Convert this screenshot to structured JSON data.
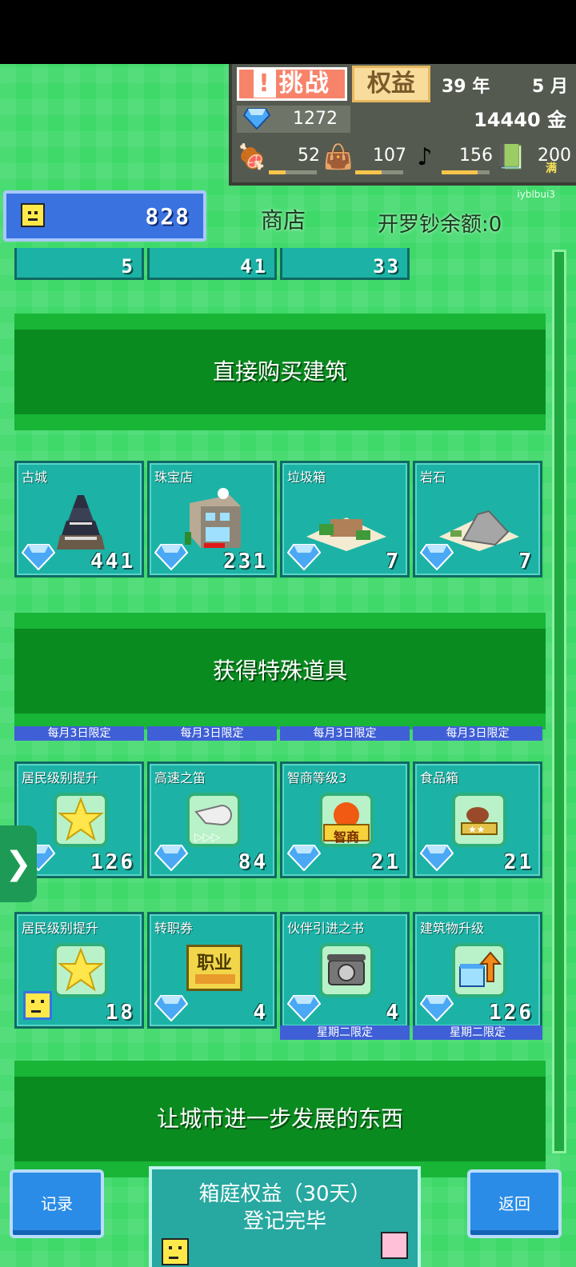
{
  "hud": {
    "challenge_mark": "!",
    "challenge_label": "挑战",
    "rights_label": "权益",
    "year": "39 年",
    "month": "5 月",
    "gems": "1272",
    "gold": "14440 金",
    "stats": [
      {
        "icon": "food-icon",
        "value": "52",
        "fill": 0.35
      },
      {
        "icon": "bag-icon",
        "value": "107",
        "fill": 0.55
      },
      {
        "icon": "music-note-icon",
        "value": "156",
        "fill": 0.75
      },
      {
        "icon": "book-icon",
        "value": "200",
        "fill": 1.0
      }
    ],
    "full_badge": "满"
  },
  "watermark": "iyblbui3",
  "header": {
    "resident_count": "828",
    "shop_title": "商店",
    "cairo_balance": "开罗钞余额:0"
  },
  "partial_row": [
    "5",
    "41",
    "33"
  ],
  "banners": {
    "buy_buildings": "直接购买建筑",
    "special_items": "获得特殊道具",
    "city_growth": "让城市进一步发展的东西"
  },
  "buildings": [
    {
      "name": "古城",
      "price": "441"
    },
    {
      "name": "珠宝店",
      "price": "231"
    },
    {
      "name": "垃圾箱",
      "price": "7"
    },
    {
      "name": "岩石",
      "price": "7"
    }
  ],
  "special_limit_label": "每月3日限定",
  "special_items": [
    {
      "name": "居民级别提升",
      "price": "126",
      "icon": "star-icon"
    },
    {
      "name": "高速之笛",
      "price": "84",
      "icon": "whistle-icon"
    },
    {
      "name": "智商等级3",
      "price": "21",
      "icon": "iq-apple-icon",
      "icon_text": "智商"
    },
    {
      "name": "食品箱",
      "price": "21",
      "icon": "food-box-icon"
    }
  ],
  "items_row2": [
    {
      "name": "居民级别提升",
      "price": "18",
      "icon": "star-icon",
      "currency": "resident"
    },
    {
      "name": "转职券",
      "price": "4",
      "icon": "job-ticket-icon",
      "icon_text": "职业"
    },
    {
      "name": "伙伴引进之书",
      "price": "4",
      "icon": "phone-icon",
      "limit": "星期二限定"
    },
    {
      "name": "建筑物升级",
      "price": "126",
      "icon": "building-upgrade-icon",
      "limit": "星期二限定"
    }
  ],
  "bottom": {
    "records_label": "记录",
    "back_label": "返回",
    "center_line1": "箱庭权益（30天）",
    "center_line2": "登记完毕"
  },
  "colors": {
    "background": "#3fd96a",
    "tile": "#1cb3a6",
    "banner": "#0a8b1f",
    "limit_tag": "#3f5fd6"
  }
}
